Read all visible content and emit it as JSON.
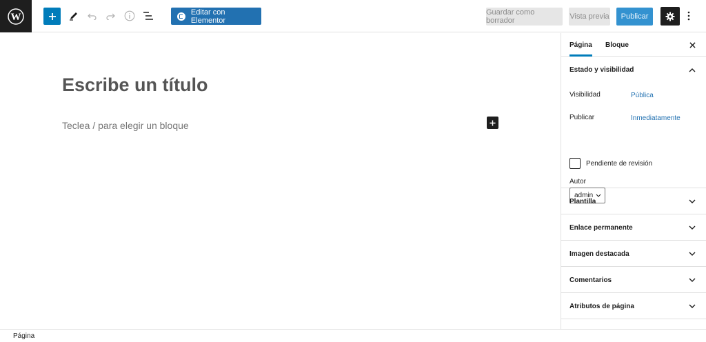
{
  "toolbar": {
    "elementor_label": "Editar con Elementor",
    "draft_label": "Guardar como borrador",
    "preview_label": "Vista previa",
    "publish_label": "Publicar",
    "icons": [
      "wordpress-logo",
      "plus-icon",
      "pencil-icon",
      "undo-icon",
      "redo-icon",
      "info-icon",
      "list-view-icon",
      "gear-icon",
      "more-vertical-icon"
    ]
  },
  "editor": {
    "title_placeholder": "Escribe un título",
    "block_placeholder": "Teclea / para elegir un bloque"
  },
  "sidebar": {
    "tabs": [
      "Página",
      "Bloque"
    ],
    "active_tab": "Página",
    "status_panel": {
      "title": "Estado y visibilidad",
      "visibility_label": "Visibilidad",
      "visibility_value": "Pública",
      "publish_label": "Publicar",
      "publish_value": "Inmediatamente",
      "pending_review_label": "Pendiente de revisión",
      "pending_review_checked": false,
      "author_label": "Autor",
      "author_value": "admin"
    },
    "panels": [
      "Plantilla",
      "Enlace permanente",
      "Imagen destacada",
      "Comentarios",
      "Atributos de página"
    ]
  },
  "footer": {
    "breadcrumb": "Página"
  },
  "colors": {
    "accent": "#007cba",
    "link": "#2271b1",
    "dark": "#1e1e1e"
  }
}
